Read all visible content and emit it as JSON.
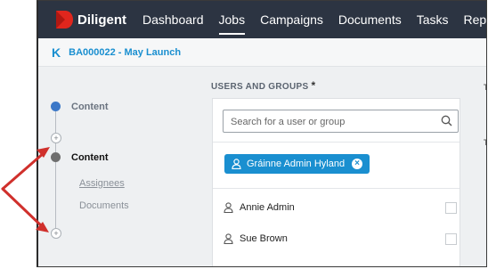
{
  "app": {
    "brand": "Diligent"
  },
  "nav": {
    "items": [
      {
        "label": "Dashboard",
        "active": false
      },
      {
        "label": "Jobs",
        "active": true
      },
      {
        "label": "Campaigns",
        "active": false
      },
      {
        "label": "Documents",
        "active": false
      },
      {
        "label": "Tasks",
        "active": false
      },
      {
        "label": "Reporting",
        "active": false
      }
    ]
  },
  "breadcrumb": {
    "back_icon": "K",
    "label": "BA000022 - May Launch"
  },
  "steps": {
    "step1": {
      "label": "Content",
      "state": "complete"
    },
    "step2": {
      "label": "Content",
      "state": "current"
    },
    "subitems": [
      {
        "label": "Assignees"
      },
      {
        "label": "Documents"
      }
    ],
    "add_icon": "+"
  },
  "users": {
    "title": "USERS AND GROUPS",
    "required_mark": "*",
    "search_placeholder": "Search for a user or group",
    "selected_chip": {
      "label": "Gráinne Admin Hyland",
      "close_icon": "×"
    },
    "list": [
      {
        "name": "Annie Admin",
        "checked": false
      },
      {
        "name": "Sue Brown",
        "checked": false
      }
    ]
  },
  "colors": {
    "nav_bg": "#2c3442",
    "accent": "#1a8fd0",
    "annotation": "#d0302c",
    "logo_red": "#e0261d"
  },
  "annotation": {
    "type": "arrows",
    "points_to": "add-step-buttons"
  }
}
